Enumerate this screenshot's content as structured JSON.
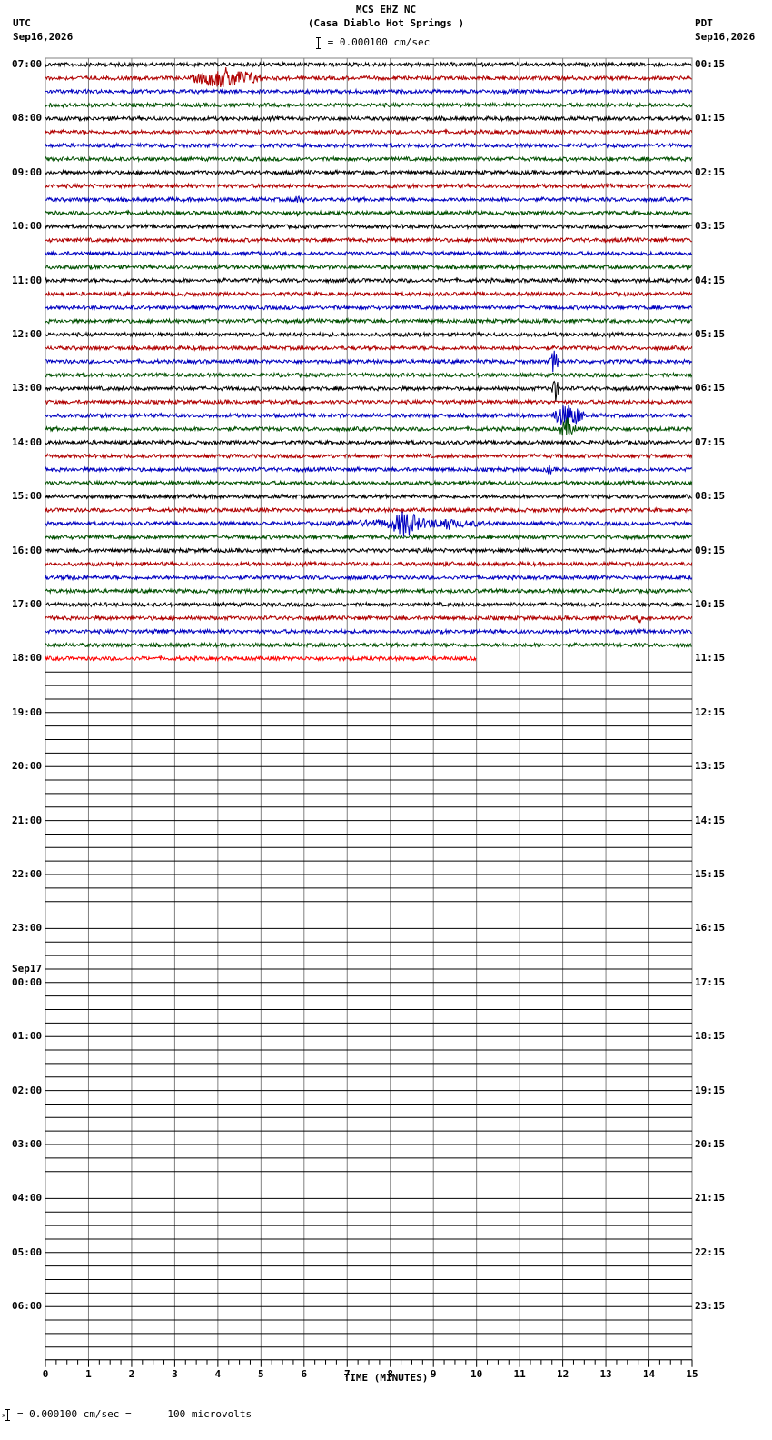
{
  "header": {
    "station": "MCS EHZ NC",
    "location": "(Casa Diablo Hot Springs )",
    "scale_text": "= 0.000100 cm/sec",
    "left_tz": "UTC",
    "left_date": "Sep16,2026",
    "right_tz": "PDT",
    "right_date": "Sep16,2026"
  },
  "footer": {
    "scale_text": "= 0.000100 cm/sec =      100 microvolts",
    "prefix": "x"
  },
  "chart_data": {
    "type": "line",
    "title": "MCS EHZ NC (Casa Diablo Hot Springs )",
    "xlabel": "TIME (MINUTES)",
    "xlim": [
      0,
      15
    ],
    "x_ticks": [
      0,
      1,
      2,
      3,
      4,
      5,
      6,
      7,
      8,
      9,
      10,
      11,
      12,
      13,
      14,
      15
    ],
    "rows_per_hour": 4,
    "row_minutes": 15,
    "total_rows": 96,
    "filled_rows": 45,
    "last_row_end_minute": 10,
    "grid": true,
    "trace_colors": [
      "#000000",
      "#b00000",
      "#0000c0",
      "#005000"
    ],
    "last_trace_color": "#ff0000",
    "left_hour_labels": [
      "07:00",
      "08:00",
      "09:00",
      "10:00",
      "11:00",
      "12:00",
      "13:00",
      "14:00",
      "15:00",
      "16:00",
      "17:00",
      "18:00",
      "19:00",
      "20:00",
      "21:00",
      "22:00",
      "23:00",
      "00:00",
      "01:00",
      "02:00",
      "03:00",
      "04:00",
      "05:00",
      "06:00"
    ],
    "date_change_label": "Sep17",
    "right_hour_labels": [
      "00:15",
      "01:15",
      "02:15",
      "03:15",
      "04:15",
      "05:15",
      "06:15",
      "07:15",
      "08:15",
      "09:15",
      "10:15",
      "11:15",
      "12:15",
      "13:15",
      "14:15",
      "15:15",
      "16:15",
      "17:15",
      "18:15",
      "19:15",
      "20:15",
      "21:15",
      "22:15",
      "23:15"
    ],
    "events": [
      {
        "row": 1,
        "start_min": 3.4,
        "end_min": 5.0,
        "amplitude": 12
      },
      {
        "row": 10,
        "start_min": 5.7,
        "end_min": 6.0,
        "amplitude": 6
      },
      {
        "row": 11,
        "start_min": 5.8,
        "end_min": 5.9,
        "amplitude": 6
      },
      {
        "row": 22,
        "start_min": 11.7,
        "end_min": 11.9,
        "amplitude": 14
      },
      {
        "row": 24,
        "start_min": 11.75,
        "end_min": 11.9,
        "amplitude": 16
      },
      {
        "row": 26,
        "start_min": 11.75,
        "end_min": 12.5,
        "amplitude": 14
      },
      {
        "row": 27,
        "start_min": 11.9,
        "end_min": 12.3,
        "amplitude": 12
      },
      {
        "row": 30,
        "start_min": 11.6,
        "end_min": 11.8,
        "amplitude": 6
      },
      {
        "row": 34,
        "start_min": 6.5,
        "end_min": 10.5,
        "amplitude": 6
      },
      {
        "row": 34,
        "start_min": 8.0,
        "end_min": 8.7,
        "amplitude": 16
      },
      {
        "row": 34,
        "start_min": 9.1,
        "end_min": 9.5,
        "amplitude": 9
      },
      {
        "row": 37,
        "start_min": 8.6,
        "end_min": 10.0,
        "amplitude": 3
      },
      {
        "row": 38,
        "start_min": 0.0,
        "end_min": 1.2,
        "amplitude": 3
      },
      {
        "row": 41,
        "start_min": 13.7,
        "end_min": 13.9,
        "amplitude": 6
      },
      {
        "row": 42,
        "start_min": 2.0,
        "end_min": 3.5,
        "amplitude": 3
      }
    ]
  }
}
